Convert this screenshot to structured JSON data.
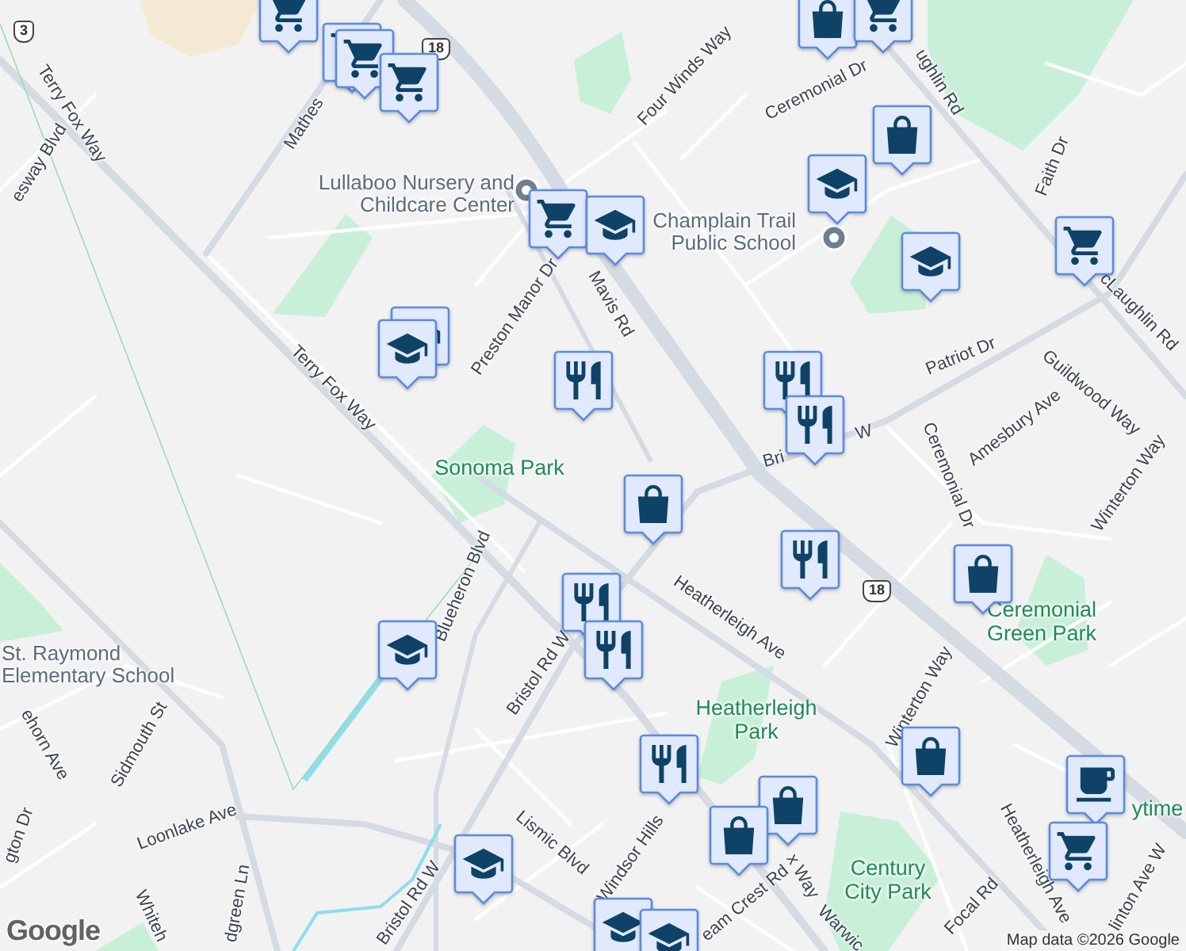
{
  "map": {
    "labels": [
      {
        "text": "esway Blvd",
        "kind": "road"
      },
      {
        "text": "Terry Fox Way",
        "kind": "road"
      },
      {
        "text": "Mathes",
        "kind": "road"
      },
      {
        "text": "Lullaboo Nursery and Childcare Center",
        "kind": "poi"
      },
      {
        "text": "Four Winds Way",
        "kind": "road"
      },
      {
        "text": "Ceremonial Dr",
        "kind": "road"
      },
      {
        "text": "ughlin Rd",
        "kind": "road"
      },
      {
        "text": "Champlain Trail Public School",
        "kind": "poi"
      },
      {
        "text": "Faith Dr",
        "kind": "road"
      },
      {
        "text": "Preston Manor Dr",
        "kind": "road"
      },
      {
        "text": "Mavis Rd",
        "kind": "road"
      },
      {
        "text": "cLaughlin Rd",
        "kind": "road"
      },
      {
        "text": "Patriot Dr",
        "kind": "road"
      },
      {
        "text": "Guildwood Way",
        "kind": "road"
      },
      {
        "text": "Amesbury Ave",
        "kind": "road"
      },
      {
        "text": "Bri",
        "kind": "road"
      },
      {
        "text": "W",
        "kind": "road"
      },
      {
        "text": "Ceremonial Dr",
        "kind": "road"
      },
      {
        "text": "Winterton Way",
        "kind": "road"
      },
      {
        "text": "Sonoma Park",
        "kind": "park"
      },
      {
        "text": "Terry Fox Way",
        "kind": "road"
      },
      {
        "text": "Heatherleigh Ave",
        "kind": "road"
      },
      {
        "text": "Ceremonial Green Park",
        "kind": "park"
      },
      {
        "text": "St. Raymond Elementary School",
        "kind": "poi"
      },
      {
        "text": "Blueheron Blvd",
        "kind": "road"
      },
      {
        "text": "Bristol Rd W",
        "kind": "road"
      },
      {
        "text": "Heatherleigh Park",
        "kind": "park"
      },
      {
        "text": "Winterton Way",
        "kind": "road"
      },
      {
        "text": "Sidmouth St",
        "kind": "road"
      },
      {
        "text": "ehorn Ave",
        "kind": "road"
      },
      {
        "text": "Loonlake Ave",
        "kind": "road"
      },
      {
        "text": "Windsor Hills",
        "kind": "road"
      },
      {
        "text": "Lismic Blvd",
        "kind": "road"
      },
      {
        "text": "x Way",
        "kind": "road"
      },
      {
        "text": "Century City Park",
        "kind": "park"
      },
      {
        "text": "Focal Rd",
        "kind": "road"
      },
      {
        "text": "Heatherleigh Ave",
        "kind": "road"
      },
      {
        "text": "ytime",
        "kind": "park"
      },
      {
        "text": "Bristol Rd W",
        "kind": "road"
      },
      {
        "text": "gton Dr",
        "kind": "road"
      },
      {
        "text": "Whiteh",
        "kind": "road"
      },
      {
        "text": "dgreen Ln",
        "kind": "road"
      },
      {
        "text": "eam Crest Rd",
        "kind": "road"
      },
      {
        "text": "Warwic",
        "kind": "road"
      },
      {
        "text": "linton Ave W",
        "kind": "road"
      },
      {
        "text": "3",
        "kind": "shield"
      },
      {
        "text": "18",
        "kind": "shield"
      },
      {
        "text": "18",
        "kind": "shield"
      }
    ],
    "markers": [
      {
        "kind": "cart"
      },
      {
        "kind": "cart"
      },
      {
        "kind": "cart"
      },
      {
        "kind": "cart"
      },
      {
        "kind": "shopping"
      },
      {
        "kind": "cart"
      },
      {
        "kind": "shopping"
      },
      {
        "kind": "school"
      },
      {
        "kind": "cart"
      },
      {
        "kind": "school"
      },
      {
        "kind": "school"
      },
      {
        "kind": "cart"
      },
      {
        "kind": "school"
      },
      {
        "kind": "school"
      },
      {
        "kind": "restaurant"
      },
      {
        "kind": "restaurant"
      },
      {
        "kind": "restaurant"
      },
      {
        "kind": "shopping"
      },
      {
        "kind": "restaurant"
      },
      {
        "kind": "shopping"
      },
      {
        "kind": "school"
      },
      {
        "kind": "restaurant"
      },
      {
        "kind": "restaurant"
      },
      {
        "kind": "restaurant"
      },
      {
        "kind": "shopping"
      },
      {
        "kind": "shopping"
      },
      {
        "kind": "shopping"
      },
      {
        "kind": "cafe"
      },
      {
        "kind": "cart"
      },
      {
        "kind": "school"
      },
      {
        "kind": "school"
      },
      {
        "kind": "school"
      }
    ],
    "logo": "Google",
    "attribution": "Map data ©2026 Google"
  }
}
